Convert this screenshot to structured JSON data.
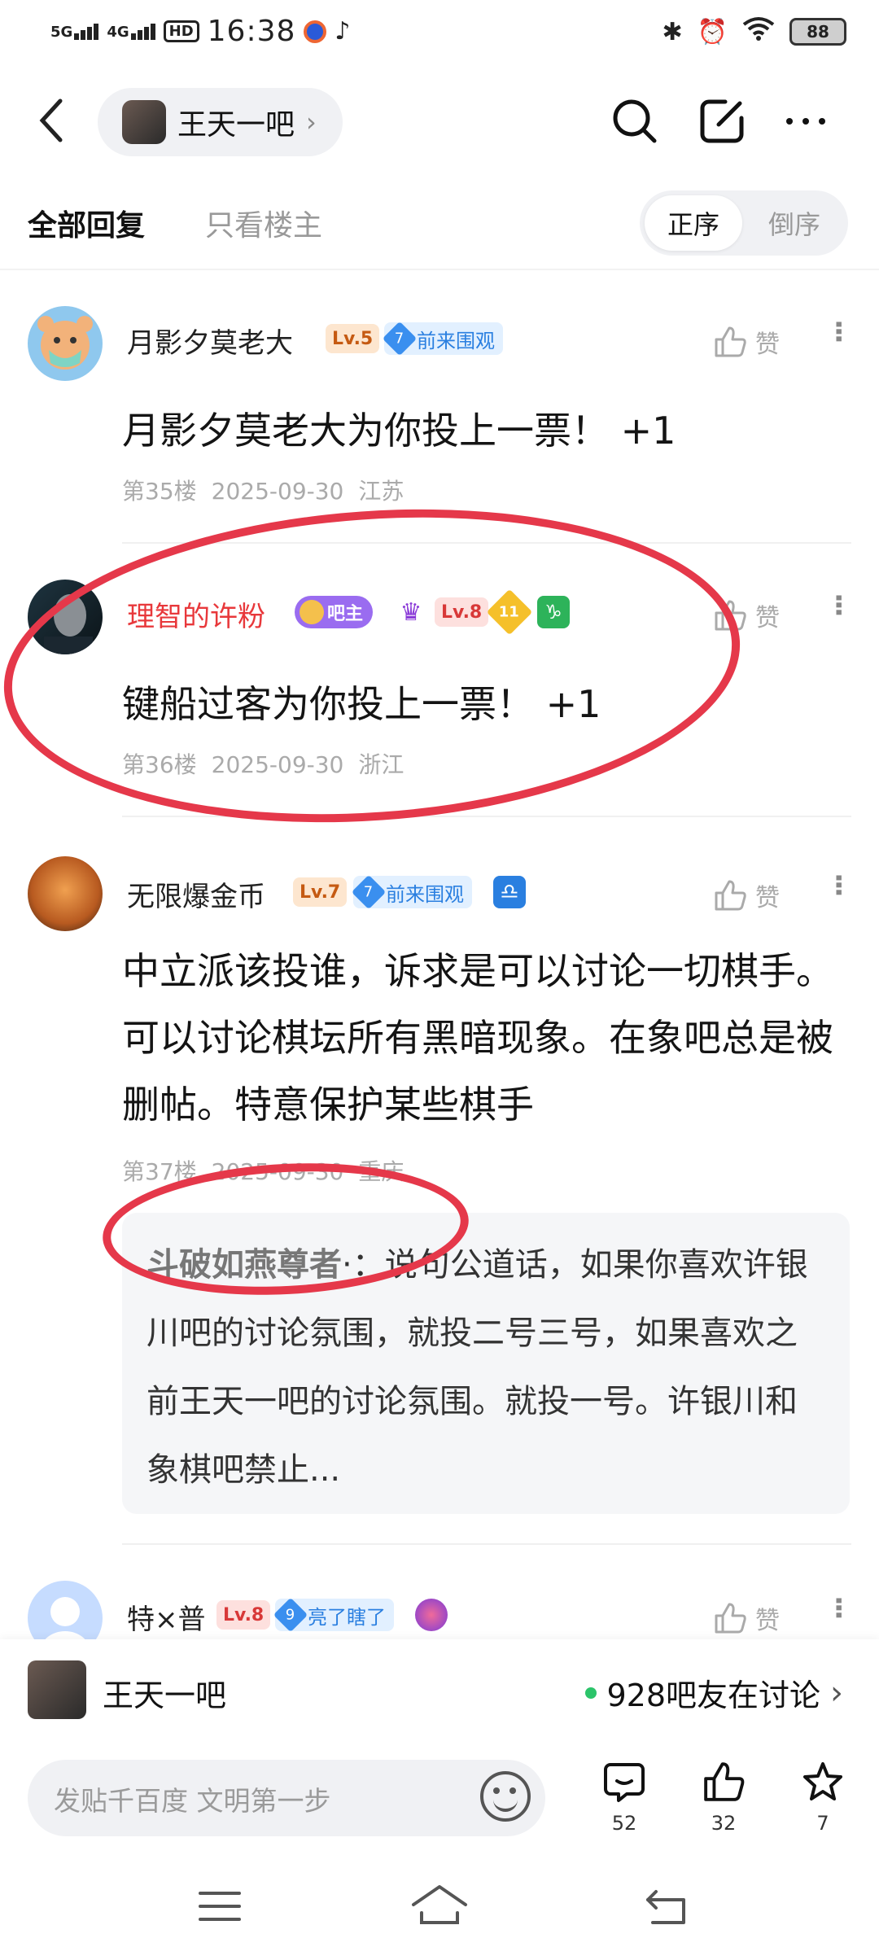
{
  "status_bar": {
    "network1": "5G",
    "network2": "4G",
    "hd": "HD",
    "time": "16:38",
    "battery": "88"
  },
  "nav": {
    "forum_name": "王天一吧"
  },
  "tabs": {
    "all": "全部回复",
    "owner_only": "只看楼主",
    "order_asc": "正序",
    "order_desc": "倒序"
  },
  "posts": [
    {
      "username": "月影夕莫老大",
      "level": "Lv.5",
      "tag_num": "7",
      "tag_text": "前来围观",
      "like": "赞",
      "content": "月影夕莫老大为你投上一票！ +1",
      "floor": "第35楼",
      "date": "2025-09-30",
      "location": "江苏"
    },
    {
      "username": "理智的许粉",
      "role": "吧主",
      "level": "Lv.8",
      "extra_badge": "11",
      "like": "赞",
      "content": "键船过客为你投上一票！ +1",
      "floor": "第36楼",
      "date": "2025-09-30",
      "location": "浙江"
    },
    {
      "username": "无限爆金币",
      "level": "Lv.7",
      "tag_num": "7",
      "tag_text": "前来围观",
      "like": "赞",
      "content": "中立派该投谁，诉求是可以讨论一切棋手。可以讨论棋坛所有黑暗现象。在象吧总是被删帖。特意保护某些棋手",
      "floor": "第37楼",
      "date": "2025-09-30",
      "location": "重庆",
      "reply": {
        "author": "斗破如燕尊者",
        "text": "·：说句公道话，如果你喜欢许银川吧的讨论氛围，就投二号三号，如果喜欢之前王天一吧的讨论氛围。就投一号。许银川和象棋吧禁止..."
      }
    },
    {
      "username": "特×普",
      "level": "Lv.8",
      "tag_num": "9",
      "tag_text": "亮了瞎了",
      "like": "赞"
    }
  ],
  "forum_bar": {
    "name": "王天一吧",
    "online": "928吧友在讨论"
  },
  "bottom": {
    "placeholder": "发贴千百度 文明第一步",
    "comments": "52",
    "likes": "32",
    "stars": "7"
  },
  "colors": {
    "red_annotation": "#e5384a",
    "accent_blue": "#2a7fe0",
    "online_green": "#2cc46a"
  }
}
